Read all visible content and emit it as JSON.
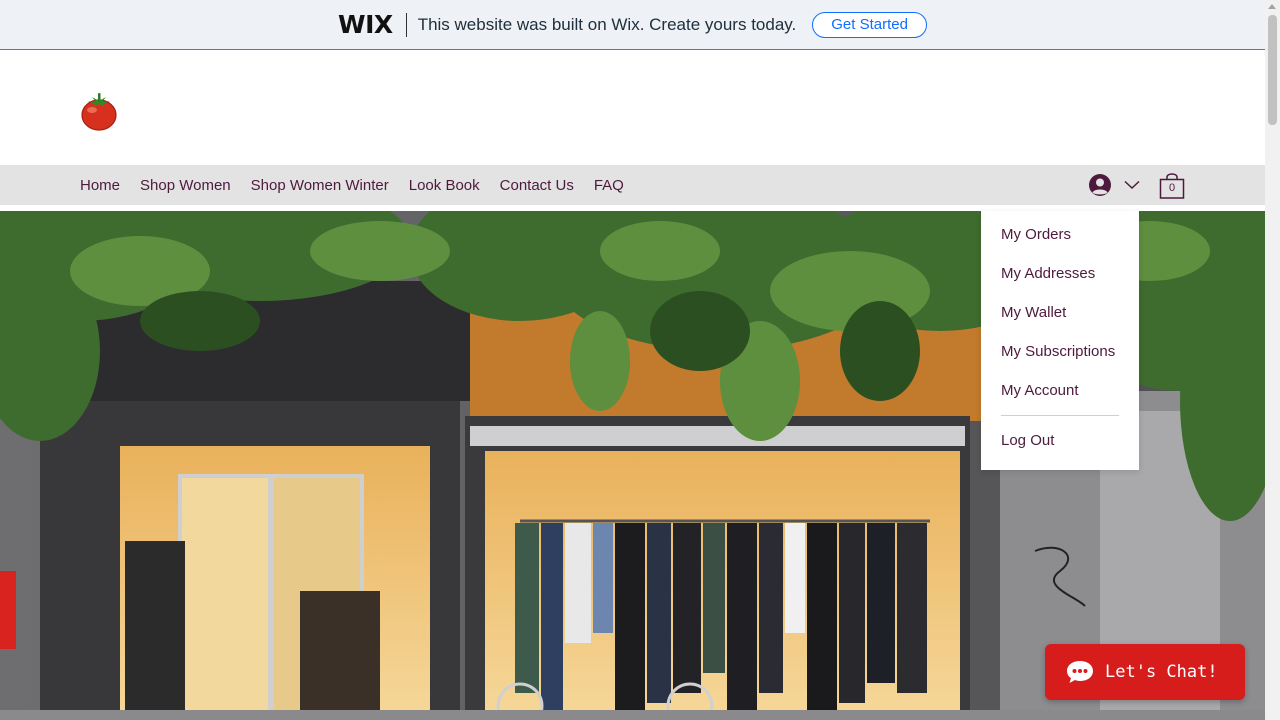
{
  "banner": {
    "logo": "WIX",
    "message": "This website was built on Wix. Create yours today.",
    "cta": "Get Started"
  },
  "header": {
    "logo_icon": "tomato-icon"
  },
  "nav": {
    "items": [
      "Home",
      "Shop Women",
      "Shop Women Winter",
      "Look Book",
      "Contact Us",
      "FAQ"
    ],
    "account_icon": "user-avatar-icon",
    "cart_count": "0"
  },
  "account_menu": {
    "items": [
      "My Orders",
      "My Addresses",
      "My Wallet",
      "My Subscriptions",
      "My Account"
    ],
    "logout": "Log Out"
  },
  "chat": {
    "label": "Let's Chat!"
  },
  "colors": {
    "nav_text": "#4d1a3d",
    "chat_bg": "#d71c1c",
    "wix_blue": "#116dff"
  }
}
